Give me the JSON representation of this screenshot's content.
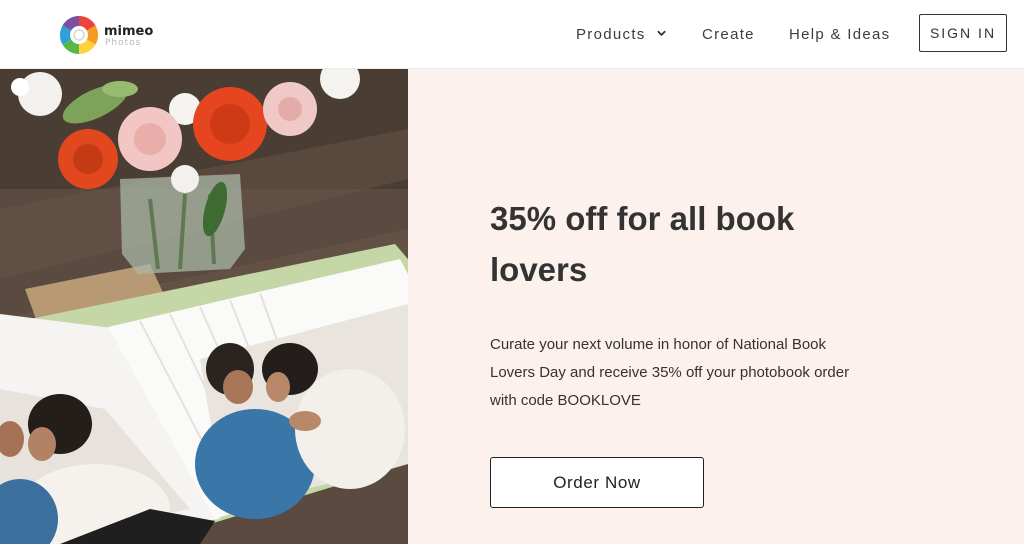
{
  "brand": {
    "name": "mimeo",
    "sub": "Photos",
    "logo_icon": "camera-aperture-logo",
    "colors": [
      "#e8453c",
      "#f59a23",
      "#fdd23e",
      "#56b947",
      "#2e9fd8",
      "#7b4fa1"
    ]
  },
  "nav": {
    "products": "Products",
    "create": "Create",
    "help": "Help & Ideas",
    "sign_in": "SIGN IN",
    "chevron_icon": "chevron-down-icon"
  },
  "hero": {
    "image": "photobook-with-flowers"
  },
  "promo": {
    "title": "35% off for all book lovers",
    "text": "Curate your next volume in honor of National Book Lovers Day and receive 35% off your photobook order with code BOOKLOVE",
    "cta": "Order Now",
    "background": "#fcf1ed"
  }
}
